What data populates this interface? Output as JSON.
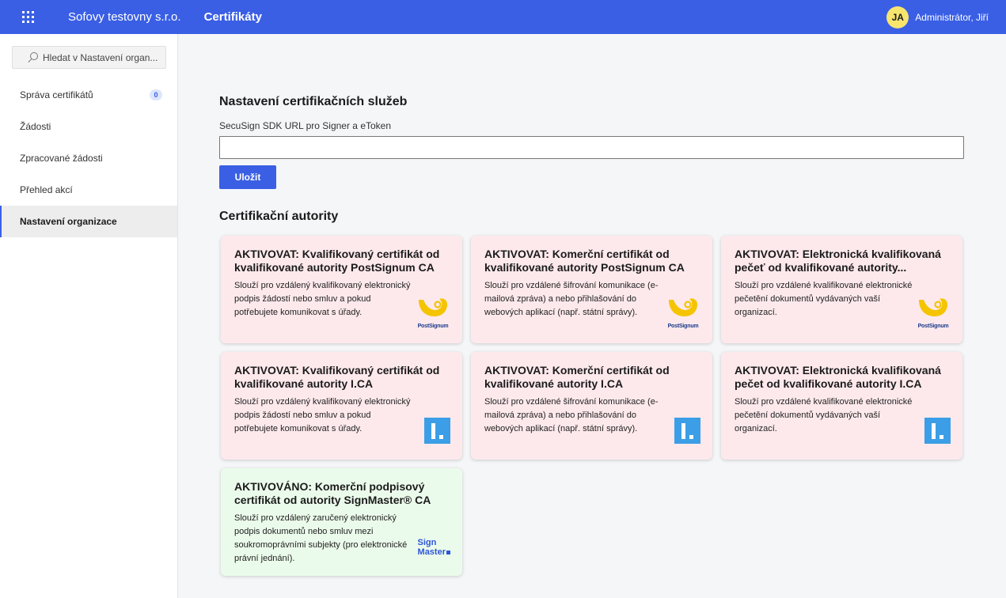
{
  "header": {
    "org_name": "Sofovy testovny s.r.o.",
    "app_title": "Certifikáty",
    "user_initials": "JA",
    "user_name": "Administrátor, Jiří"
  },
  "sidebar": {
    "search_placeholder": "Hledat v Nastavení organ...",
    "items": [
      {
        "label": "Správa certifikátů",
        "badge": "0"
      },
      {
        "label": "Žádosti"
      },
      {
        "label": "Zpracované žádosti"
      },
      {
        "label": "Přehled akcí"
      },
      {
        "label": "Nastavení organizace",
        "active": true
      }
    ]
  },
  "settings": {
    "title": "Nastavení certifikačních služeb",
    "field_label": "SecuSign SDK URL pro Signer a eToken",
    "field_value": "",
    "save_label": "Uložit"
  },
  "authorities": {
    "title": "Certifikační autority",
    "cards": [
      {
        "title": "AKTIVOVAT: Kvalifikovaný certifikát od kvalifikované autority PostSignum CA",
        "desc": "Slouží pro vzdálený kvalifikovaný elektronický podpis žádostí nebo smluv a pokud potřebujete komunikovat s úřady.",
        "logo": "postsignum-logo",
        "logo_text": "PostSignum",
        "status": "inactive"
      },
      {
        "title": "AKTIVOVAT: Komerční certifikát od kvalifikované autority PostSignum CA",
        "desc": "Slouží pro vzdálené šifrování komunikace (e-mailová zpráva) a nebo přihlašování do webových aplikací (např. státní správy).",
        "logo": "postsignum-logo",
        "logo_text": "PostSignum",
        "status": "inactive"
      },
      {
        "title": "AKTIVOVAT: Elektronická kvalifikovaná pečeť od kvalifikované autority...",
        "desc": "Slouží pro vzdálené kvalifikované elektronické pečetění dokumentů vydávaných vaší organizací.",
        "logo": "postsignum-logo",
        "logo_text": "PostSignum",
        "status": "inactive"
      },
      {
        "title": "AKTIVOVAT: Kvalifikovaný certifikát od kvalifikované autority I.CA",
        "desc": "Slouží pro vzdálený kvalifikovaný elektronický podpis žádostí nebo smluv a pokud potřebujete komunikovat s úřady.",
        "logo": "ica-logo",
        "status": "inactive"
      },
      {
        "title": "AKTIVOVAT: Komerční certifikát od kvalifikované autority I.CA",
        "desc": "Slouží pro vzdálené šifrování komunikace (e-mailová zpráva) a nebo přihlašování do webových aplikací (např. státní správy).",
        "logo": "ica-logo",
        "status": "inactive"
      },
      {
        "title": "AKTIVOVAT: Elektronická kvalifikovaná pečet od kvalifikované autority I.CA",
        "desc": "Slouží pro vzdálené kvalifikované elektronické pečetění dokumentů vydávaných vaší organizací.",
        "logo": "ica-logo",
        "status": "inactive"
      },
      {
        "title": "AKTIVOVÁNO: Komerční podpisový certifikát od autority SignMaster® CA",
        "desc": "Slouží pro vzdálený zaručený elektronický podpis dokumentů nebo smluv mezi soukromoprávními subjekty (pro elektronické právní jednání).",
        "logo": "signmaster-logo",
        "logo_text_1": "Sign",
        "logo_text_2": "Master",
        "status": "active"
      }
    ]
  },
  "colors": {
    "accent": "#3a5fe5",
    "card_inactive": "#fde9ec",
    "card_active": "#ebfbeb",
    "postsignum_yellow": "#f5c400",
    "ica_blue": "#3c9ee6"
  }
}
